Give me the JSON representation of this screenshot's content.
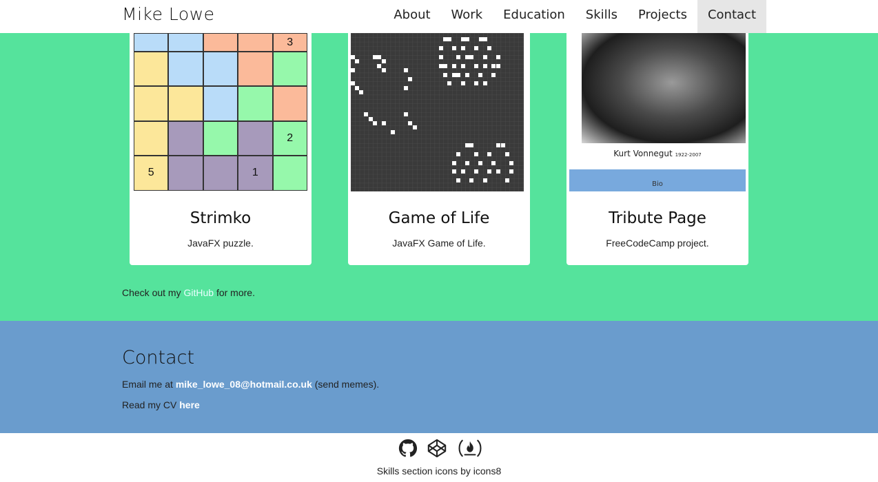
{
  "header": {
    "brand": "Mike Lowe",
    "nav": [
      "About",
      "Work",
      "Education",
      "Skills",
      "Projects",
      "Contact"
    ],
    "active": "Contact"
  },
  "projects": {
    "cards": [
      {
        "title": "Strimko",
        "desc": "JavaFX puzzle."
      },
      {
        "title": "Game of Life",
        "desc": "JavaFX Game of Life."
      },
      {
        "title": "Tribute Page",
        "desc": "FreeCodeCamp project."
      }
    ],
    "strimko_numbers": {
      "r0c4": "3",
      "r3c4": "2",
      "r4c0": "5",
      "r4c3": "1"
    },
    "tribute_caption": "Kurt Vonnegut",
    "tribute_years": "1922-2007",
    "tribute_button": "Bio",
    "more_prefix": "Check out my",
    "more_link": "GitHub",
    "more_suffix": "for more."
  },
  "contact": {
    "title": "Contact",
    "email_prefix": "Email me at",
    "email": "mike_lowe_08@hotmail.co.uk",
    "email_suffix": "(send memes).",
    "cv_prefix": "Read my CV",
    "cv_link": "here"
  },
  "footer": {
    "icons": [
      "github-icon",
      "codepen-icon",
      "freecodecamp-icon"
    ],
    "credit": "Skills section icons by icons8"
  },
  "colors": {
    "projects_bg": "#55e39c",
    "contact_bg": "#6a9ccd"
  }
}
